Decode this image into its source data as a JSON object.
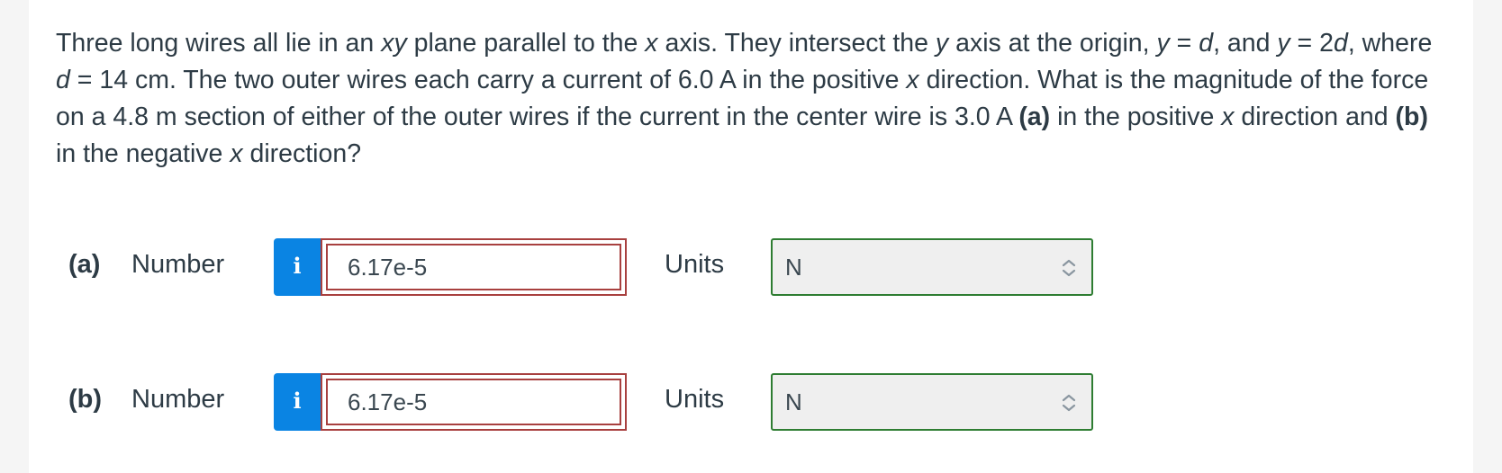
{
  "question": {
    "seg1": "Three long wires all lie in an ",
    "var_xy": "xy",
    "seg2": " plane parallel to the ",
    "var_x1": "x",
    "seg3": " axis. They intersect the ",
    "var_y1": "y",
    "seg4": " axis at the origin, ",
    "var_y2": "y",
    "seg5": " = ",
    "var_d1": "d",
    "seg6": ", and ",
    "var_y3": "y",
    "seg7": " = 2",
    "var_d2": "d",
    "seg8": ", where ",
    "var_d3": "d",
    "seg9": " = 14 cm. The two outer wires each carry a current of 6.0 A in the positive ",
    "var_x2": "x",
    "seg10": " direction. What is the magnitude of the force on a 4.8 m section of either of the outer wires if the current in the center wire is 3.0 A ",
    "part_a": "(a)",
    "seg11": " in the positive ",
    "var_x3": "x",
    "seg12": " direction and ",
    "part_b": "(b)",
    "seg13": " in the negative ",
    "var_x4": "x",
    "seg14": " direction?"
  },
  "answers": [
    {
      "part_label": "(a)",
      "number_label": "Number",
      "info_icon": "i",
      "value": "6.17e-5",
      "units_label": "Units",
      "units_value": "N"
    },
    {
      "part_label": "(b)",
      "number_label": "Number",
      "info_icon": "i",
      "value": "6.17e-5",
      "units_label": "Units",
      "units_value": "N"
    }
  ],
  "colors": {
    "info_button": "#0a84e3",
    "answer_border_incorrect": "#a8403f",
    "units_border_correct": "#2e7d32"
  }
}
